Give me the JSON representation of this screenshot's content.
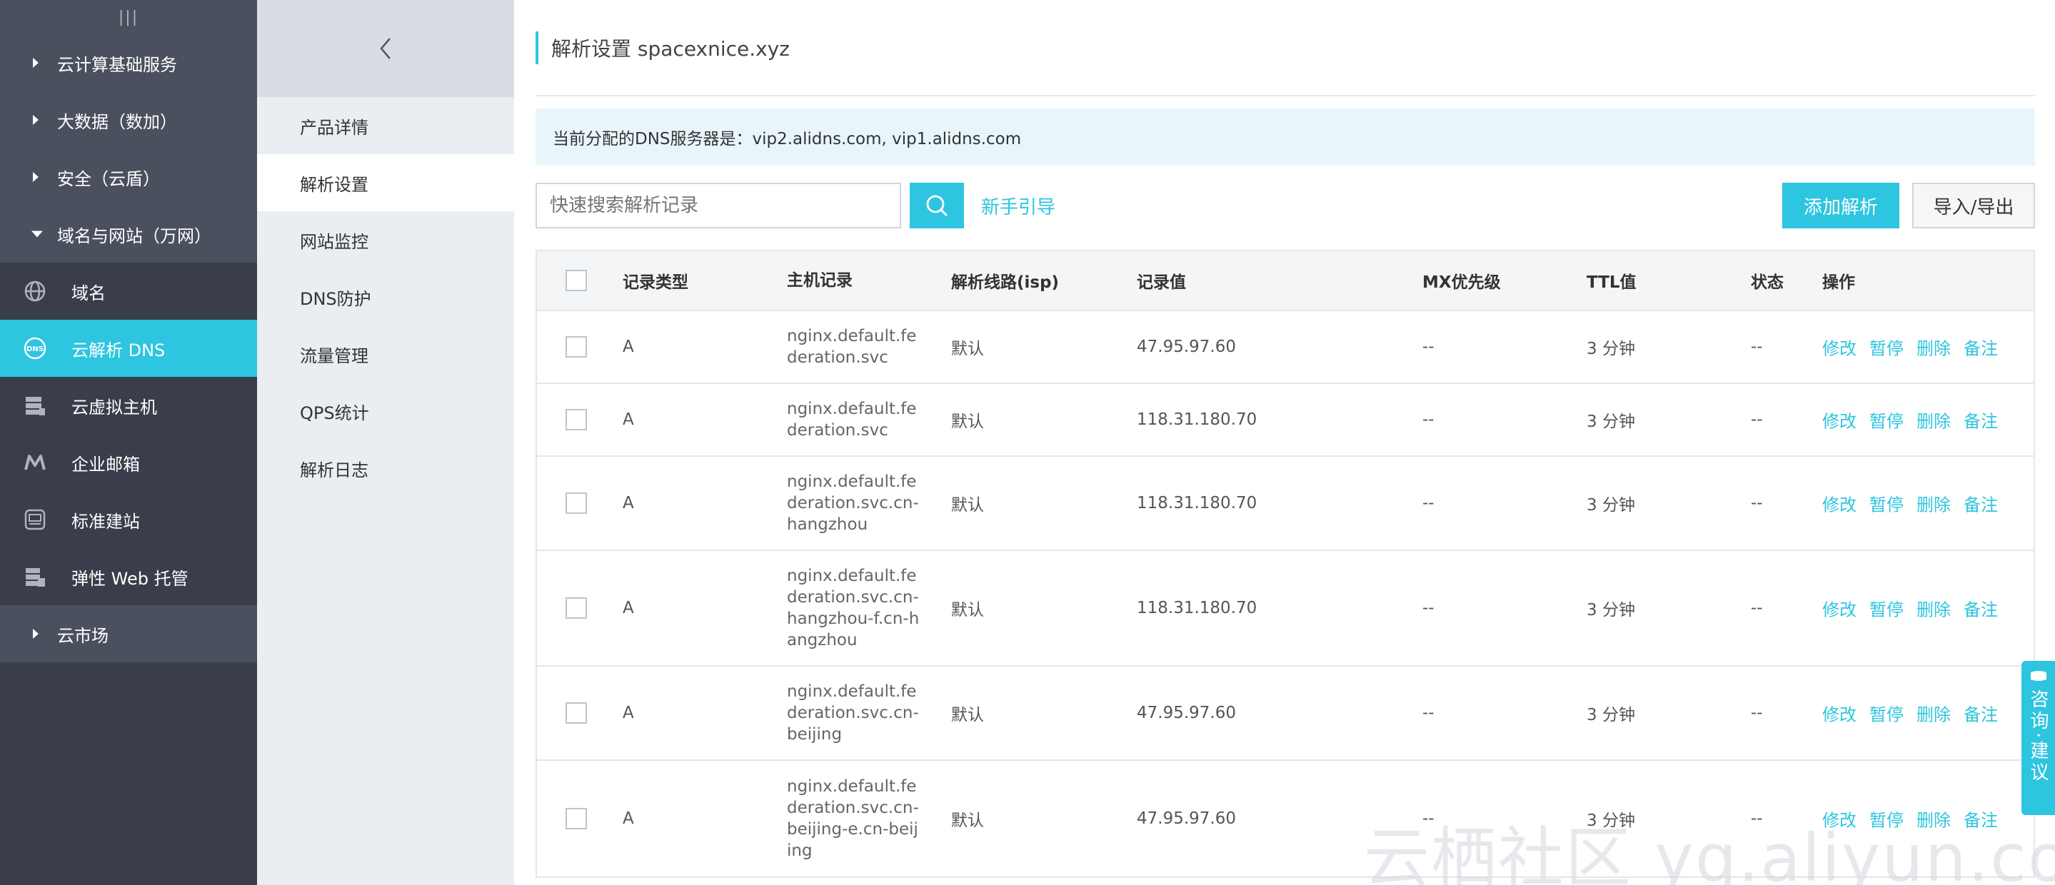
{
  "sidebar": {
    "top_glyph": "|||",
    "groups": [
      {
        "label": "云计算基础服务"
      },
      {
        "label": "大数据（数加）"
      },
      {
        "label": "安全（云盾）"
      },
      {
        "label": "域名与网站（万网）"
      }
    ],
    "items": [
      {
        "label": "域名",
        "icon": "globe-icon"
      },
      {
        "label": "云解析 DNS",
        "icon": "dns-icon"
      },
      {
        "label": "云虚拟主机",
        "icon": "server-icon"
      },
      {
        "label": "企业邮箱",
        "icon": "mail-m-icon"
      },
      {
        "label": "标准建站",
        "icon": "website-icon"
      },
      {
        "label": "弹性 Web 托管",
        "icon": "web-hosting-icon"
      }
    ],
    "bottom_group": {
      "label": "云市场"
    }
  },
  "subnav": {
    "items": [
      "产品详情",
      "解析设置",
      "网站监控",
      "DNS防护",
      "流量管理",
      "QPS统计",
      "解析日志"
    ]
  },
  "main": {
    "title": "解析设置 spacexnice.xyz",
    "notice": "当前分配的DNS服务器是：vip2.alidns.com, vip1.alidns.com",
    "search_placeholder": "快速搜索解析记录",
    "guide_link": "新手引导",
    "add_button": "添加解析",
    "import_export_button": "导入/导出"
  },
  "table": {
    "headers": {
      "type": "记录类型",
      "host": "主机记录",
      "line": "解析线路(isp)",
      "value": "记录值",
      "mx": "MX优先级",
      "ttl": "TTL值",
      "status": "状态",
      "ops": "操作"
    },
    "ops": [
      "修改",
      "暂停",
      "删除",
      "备注"
    ],
    "rows": [
      {
        "type": "A",
        "host": "nginx.default.federation.svc",
        "line": "默认",
        "value": "47.95.97.60",
        "mx": "--",
        "ttl": "3 分钟",
        "status": "--"
      },
      {
        "type": "A",
        "host": "nginx.default.federation.svc",
        "line": "默认",
        "value": "118.31.180.70",
        "mx": "--",
        "ttl": "3 分钟",
        "status": "--"
      },
      {
        "type": "A",
        "host": "nginx.default.federation.svc.cn-hangzhou",
        "line": "默认",
        "value": "118.31.180.70",
        "mx": "--",
        "ttl": "3 分钟",
        "status": "--"
      },
      {
        "type": "A",
        "host": "nginx.default.federation.svc.cn-hangzhou-f.cn-hangzhou",
        "line": "默认",
        "value": "118.31.180.70",
        "mx": "--",
        "ttl": "3 分钟",
        "status": "--"
      },
      {
        "type": "A",
        "host": "nginx.default.federation.svc.cn-beijing",
        "line": "默认",
        "value": "47.95.97.60",
        "mx": "--",
        "ttl": "3 分钟",
        "status": "--"
      },
      {
        "type": "A",
        "host": "nginx.default.federation.svc.cn-beijing-e.cn-beijing",
        "line": "默认",
        "value": "47.95.97.60",
        "mx": "--",
        "ttl": "3 分钟",
        "status": "--"
      }
    ]
  },
  "consult": {
    "text": "咨询·建议"
  },
  "watermark": "云栖社区 yq.aliyun.com",
  "colors": {
    "accent": "#2ec5e0",
    "sidebar": "#393e4a",
    "sidebar_group": "#4a505e",
    "subnav": "#eaedf1"
  }
}
